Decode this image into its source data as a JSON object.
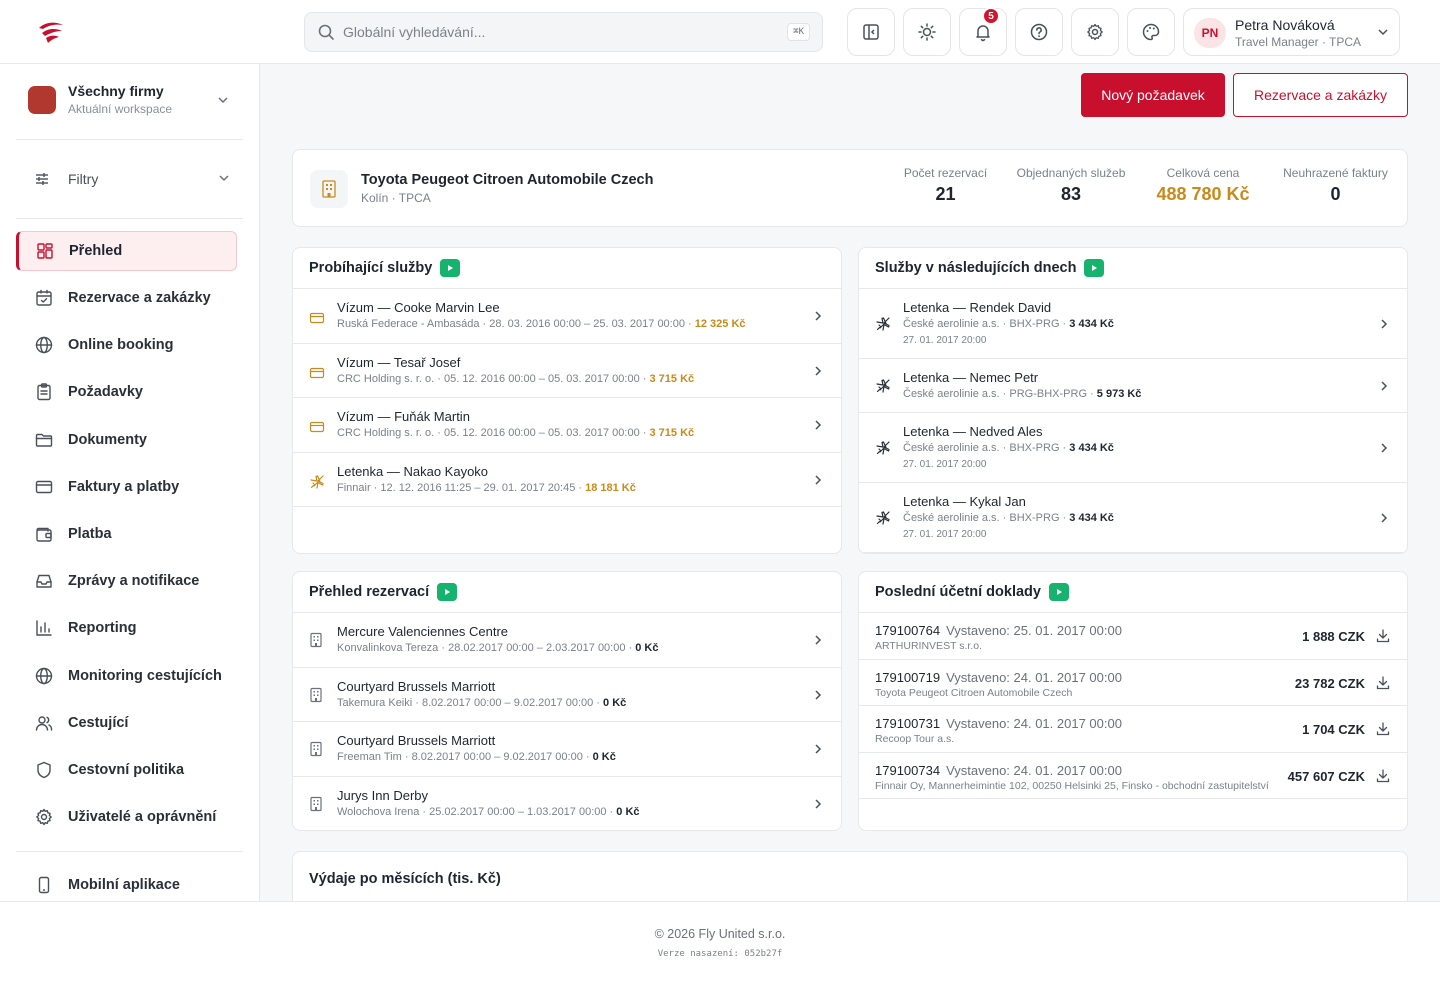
{
  "header": {
    "search_placeholder": "Globální vyhledávání...",
    "search_shortcut": "⌘K",
    "notifications_count": "5",
    "user": {
      "initials": "PN",
      "name": "Petra Nováková",
      "role": "Travel Manager · TPCA"
    }
  },
  "sidebar": {
    "workspace": {
      "title": "Všechny firmy",
      "subtitle": "Aktuální workspace"
    },
    "filters_label": "Filtry",
    "items": [
      {
        "label": "Přehled",
        "icon": "dashboard-icon"
      },
      {
        "label": "Rezervace a zakázky",
        "icon": "calendar-check-icon"
      },
      {
        "label": "Online booking",
        "icon": "globe-icon"
      },
      {
        "label": "Požadavky",
        "icon": "clipboard-icon"
      },
      {
        "label": "Dokumenty",
        "icon": "folder-icon"
      },
      {
        "label": "Faktury a platby",
        "icon": "credit-card-icon"
      },
      {
        "label": "Platba",
        "icon": "wallet-icon"
      },
      {
        "label": "Zprávy a notifikace",
        "icon": "inbox-icon"
      },
      {
        "label": "Reporting",
        "icon": "bar-chart-icon"
      },
      {
        "label": "Monitoring cestujících",
        "icon": "globe-icon"
      },
      {
        "label": "Cestující",
        "icon": "users-icon"
      },
      {
        "label": "Cestovní politika",
        "icon": "shield-icon"
      },
      {
        "label": "Uživatelé a oprávnění",
        "icon": "gear-icon"
      }
    ],
    "mobile_app": "Mobilní aplikace"
  },
  "actions": {
    "new_request": "Nový požadavek",
    "reservations": "Rezervace a zakázky"
  },
  "company": {
    "name": "Toyota Peugeot Citroen Automobile Czech",
    "location": "Kolín · TPCA",
    "stats": [
      {
        "label": "Počet rezervací",
        "value": "21"
      },
      {
        "label": "Objednaných služeb",
        "value": "83"
      },
      {
        "label": "Celková cena",
        "value": "488 780 Kč"
      },
      {
        "label": "Neuhrazené faktury",
        "value": "0"
      }
    ]
  },
  "ongoing": {
    "title": "Probíhající služby",
    "rows": [
      {
        "title": "Vízum — Cooke Marvin Lee",
        "sub": "Ruská Federace - Ambasáda · 28. 03. 2016 00:00 – 25. 03. 2017 00:00 · ",
        "price": "12 325 Kč",
        "icon": "card-icon"
      },
      {
        "title": "Vízum — Tesař Josef",
        "sub": "CRC Holding s. r. o. · 05. 12. 2016 00:00 – 05. 03. 2017 00:00 · ",
        "price": "3 715 Kč",
        "icon": "card-icon"
      },
      {
        "title": "Vízum — Fuňák Martin",
        "sub": "CRC Holding s. r. o. · 05. 12. 2016 00:00 – 05. 03. 2017 00:00 · ",
        "price": "3 715 Kč",
        "icon": "card-icon"
      },
      {
        "title": "Letenka — Nakao Kayoko",
        "sub": "Finnair · 12. 12. 2016 11:25 – 29. 01. 2017 20:45 · ",
        "price": "18 181 Kč",
        "icon": "plane-icon"
      }
    ]
  },
  "upcoming": {
    "title": "Služby v následujících dnech",
    "rows": [
      {
        "title": "Letenka — Rendek David",
        "sub": "České aerolinie a.s. · BHX-PRG · ",
        "price": "3 434 Kč",
        "date": "27. 01. 2017 20:00"
      },
      {
        "title": "Letenka — Nemec Petr",
        "sub": "České aerolinie a.s. · PRG-BHX-PRG · ",
        "price": "5 973 Kč",
        "date": ""
      },
      {
        "title": "Letenka — Nedved Ales",
        "sub": "České aerolinie a.s. · BHX-PRG · ",
        "price": "3 434 Kč",
        "date": "27. 01. 2017 20:00"
      },
      {
        "title": "Letenka — Kykal Jan",
        "sub": "České aerolinie a.s. · BHX-PRG · ",
        "price": "3 434 Kč",
        "date": "27. 01. 2017 20:00"
      }
    ]
  },
  "reservations": {
    "title": "Přehled rezervací",
    "rows": [
      {
        "title": "Mercure Valenciennes Centre",
        "sub": "Konvalinkova Tereza · 28.02.2017 00:00 – 2.03.2017 00:00 · ",
        "price": "0 Kč"
      },
      {
        "title": "Courtyard Brussels Marriott",
        "sub": "Takemura Keiki · 8.02.2017 00:00 – 9.02.2017 00:00 · ",
        "price": "0 Kč"
      },
      {
        "title": "Courtyard Brussels Marriott",
        "sub": "Freeman Tim · 8.02.2017 00:00 – 9.02.2017 00:00 · ",
        "price": "0 Kč"
      },
      {
        "title": "Jurys Inn Derby",
        "sub": "Wolochova Irena · 25.02.2017 00:00 – 1.03.2017 00:00 · ",
        "price": "0 Kč"
      }
    ]
  },
  "invoices": {
    "title": "Poslední účetní doklady",
    "rows": [
      {
        "number": "179100764",
        "issued": "Vystaveno: 25. 01. 2017 00:00",
        "company": "ARTHURINVEST s.r.o.",
        "amount": "1 888 CZK"
      },
      {
        "number": "179100719",
        "issued": "Vystaveno: 24. 01. 2017 00:00",
        "company": "Toyota Peugeot Citroen Automobile Czech",
        "amount": "23 782 CZK"
      },
      {
        "number": "179100731",
        "issued": "Vystaveno: 24. 01. 2017 00:00",
        "company": "Recoop Tour a.s.",
        "amount": "1 704 CZK"
      },
      {
        "number": "179100734",
        "issued": "Vystaveno: 24. 01. 2017 00:00",
        "company": "Finnair Oy, Mannerheimintie 102, 00250 Helsinki 25, Finsko - obchodní zastupitelství",
        "amount": "457 607 CZK"
      }
    ]
  },
  "monthly": {
    "title": "Výdaje po měsících (tis. Kč)"
  },
  "footer": {
    "copyright": "© 2026 Fly United s.r.o.",
    "version": "Verze nasazení: 052b27f"
  },
  "colors": {
    "brand": "#c8102e",
    "accent_gold": "#c98a1c",
    "play_green": "#16b36e"
  }
}
